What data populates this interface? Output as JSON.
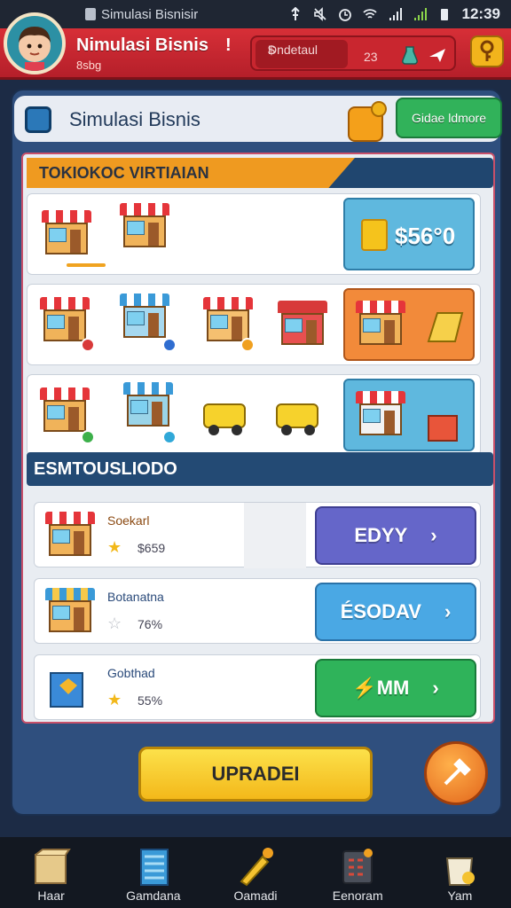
{
  "status_bar": {
    "app_name": "Simulasi Bisnisir",
    "time": "12:39"
  },
  "header": {
    "title": "Nimulasi Bisnis",
    "subtitle": "8sbg",
    "pin": "!",
    "resource_label": "Dndetaul",
    "resource_small": "$",
    "resource_value": "23"
  },
  "title_bar": {
    "title": "Simulasi Bisnis",
    "button_label": "Gidae ldmore"
  },
  "section_toko": {
    "heading": "TOKIOKOC VIRTIAIAN",
    "price": "$56°0"
  },
  "section_bisnis": {
    "heading": "ESMTOUSLIODO",
    "items": [
      {
        "name": "Soekarl",
        "value": "$659",
        "action": "EDYY",
        "star": "filled",
        "color": "#6566c9"
      },
      {
        "name": "Botanatna",
        "value": "76%",
        "action": "ÉSODAV",
        "star": "empty",
        "color": "#4aa8e4"
      },
      {
        "name": "Gobthad",
        "value": "55%",
        "action": "⚡MM",
        "star": "filled",
        "color": "#2fb35a"
      }
    ]
  },
  "upgrade_button": "UPRADEI",
  "bottom_nav": [
    {
      "label": "Haar",
      "icon": "box-icon"
    },
    {
      "label": "Gamdana",
      "icon": "building-icon"
    },
    {
      "label": "Oamadi",
      "icon": "pencil-icon"
    },
    {
      "label": "Eenoram",
      "icon": "calculator-icon"
    },
    {
      "label": "Yam",
      "icon": "bag-icon"
    }
  ],
  "colors": {
    "header_red": "#c9262f",
    "accent_orange": "#ef9a20",
    "panel_blue": "#2f4f7e"
  }
}
